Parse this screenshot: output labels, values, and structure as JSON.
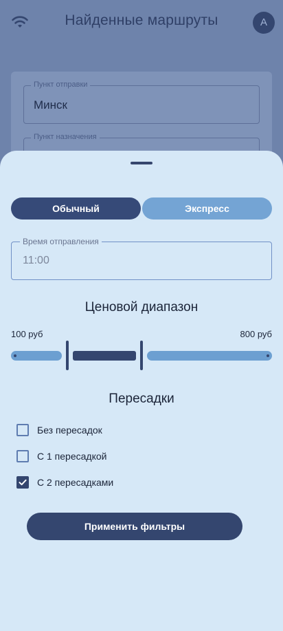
{
  "header": {
    "title": "Найденные маршруты",
    "avatar_letter": "A"
  },
  "background_form": {
    "origin_label": "Пункт отправки",
    "origin_value": "Минск",
    "destination_label": "Пункт назначения"
  },
  "filters": {
    "type_options": [
      "Обычный",
      "Экспресс"
    ],
    "selected_type": "Обычный",
    "departure_time": {
      "label": "Время отправления",
      "value": "11:00"
    },
    "price": {
      "title": "Ценовой диапазон",
      "min_label": "100 руб",
      "max_label": "800 руб",
      "min": 100,
      "max": 800,
      "selected_low_fraction": 0.22,
      "selected_high_fraction": 0.5
    },
    "transfers": {
      "title": "Пересадки",
      "options": [
        {
          "label": "Без пересадок",
          "checked": false
        },
        {
          "label": "С 1 пересадкой",
          "checked": false
        },
        {
          "label": "С 2 пересадками",
          "checked": true
        }
      ]
    },
    "apply_label": "Применить фильтры"
  },
  "colors": {
    "primary": "#34466f",
    "secondary": "#74a4d4",
    "sheet_background": "#d6e8f7",
    "scrim": "#6e83ab"
  }
}
